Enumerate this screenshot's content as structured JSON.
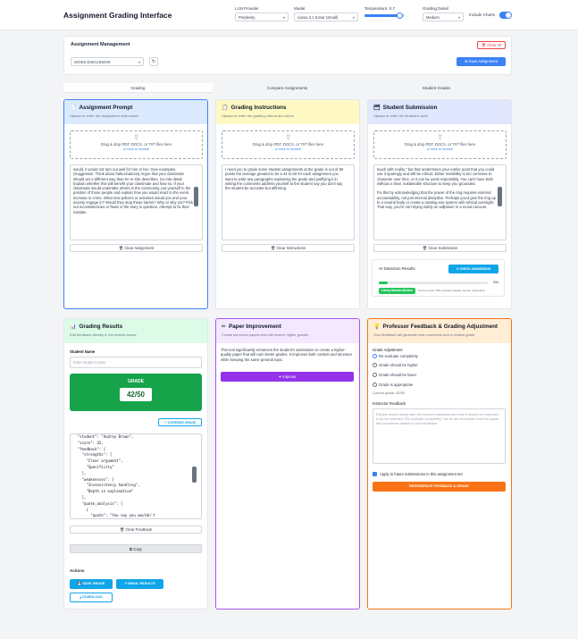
{
  "app": {
    "title": "Assignment Grading Interface"
  },
  "controls": {
    "llm_provider_label": "LLM Provider",
    "llm_provider_value": "Perplexity",
    "model_label": "Model",
    "model_value": "Llama 3.1 Sonar (Small)",
    "temperature_label": "Temperature: 0.7",
    "temperature_value": 0.7,
    "grading_detail_label": "Grading Detail",
    "grading_detail_value": "Medium",
    "include_charts_label": "Include Charts",
    "include_charts_on": true
  },
  "management": {
    "title": "Assignment Management",
    "clear_all": "Clear All",
    "selected": "GIGES DISCUSSION",
    "save_assignment": "Save Assignment"
  },
  "tabs": [
    "Grading",
    "Compare Assignments",
    "Student Grades"
  ],
  "prompt_card": {
    "title": "Assignment Prompt",
    "subtitle": "Upload or enter the assignment instructions",
    "drop_text": "Drag & drop PDF, DOCX, or TXT files here",
    "drop_link": "or click to browse",
    "text": "would, it would not turn out well for him or her. Give examples. (Suggestion: Think about hallucinations) Argue that your classmate should act a different way than he or she describes. Go into detail. Explain whether this will benefit your classmate and how so. If your classmate would undertake others in the community, put yourself in the position of those people and explain how you would react to the event increase in crime. What new policies or activities would you and your society engage in? Would they stop these harms? Why or why not? Pick out inconsistencies or flaws in the story in question. Attempt to fix their mistake.",
    "clear": "Clear Assignment"
  },
  "instructions_card": {
    "title": "Grading Instructions",
    "subtitle": "Upload or enter the grading criteria and rubric",
    "drop_text": "Drag & drop PDF, DOCX, or TXT files here",
    "drop_link": "or click to browse",
    "text": "I need you to grade some student assignments at the grade is out of 50 points the average greated to be a 44 to 50 for each assignment you want to write two paragraphs explaining the grade and justifying it in writing the comments address yourself to the student say you don't say the student be accurate but affirming",
    "clear": "Clear Instructions"
  },
  "submission_card": {
    "title": "Student Submission",
    "subtitle": "Upload or enter the student's work",
    "drop_text": "Drag & drop PDF, DOCX, or TXT files here",
    "drop_link": "or click to browse",
    "text": "touch with reality,\" but that undermines your earlier point that you could use it sparingly and still be ethical. Either invisibility is too corrosive to character over time, or it can be used responsibly. You can't have both without a clear, sustainable structure to keep you grounded.\n\nFix this by acknowledging that the power of the ring requires external accountability, not just internal discipline. Perhaps you'd give the ring up to a neutral body or create a rotating-use system with ethical oversight. That way, you're not relying solely on willpower in a moral vacuum.",
    "clear": "Clear Submission",
    "ai_title": "AI Detection Results",
    "ai_button": "CHECK SUBMISSION",
    "ai_percent_label": "8%",
    "ai_percent": 8,
    "ai_badge": "Likely Human-Written",
    "ai_note": "Scores under 30% typically indicate human authorship"
  },
  "results_card": {
    "title": "Grading Results",
    "subtitle": "Edit feedback directly in the textbox below",
    "student_name_label": "Student Name",
    "student_name_placeholder": "Enter student name",
    "grade_label": "GRADE",
    "grade_value": "42/50",
    "override": "OVERRIDE GRADE",
    "code_lines": [
      "  \"student\": \"Audrey Brown\",",
      "  \"score\": 42,",
      "  \"feedback\": {",
      "    \"strengths\": [",
      "      \"Clear argument\",",
      "      \"Specificity\"",
      "    ],",
      "    \"weaknesses\": [",
      "      \"Inconsistency handling\",",
      "      \"Depth in explanation\"",
      "    ],",
      "    \"quote_analysis\": [",
      "      {",
      "        \"quote\": \"You say you wouldn't"
    ],
    "clear_feedback": "Clear Feedback",
    "copy": "Copy",
    "actions_label": "Actions",
    "save_grade": "SAVE GRADE",
    "email_results": "EMAIL RESULTS",
    "download": "DOWNLOAD"
  },
  "improve_card": {
    "title": "Paper Improvement",
    "subtitle": "Create improved papers that will receive higher grades",
    "text": "This tool significantly enhances the student's submission to create a higher-quality paper that will earn better grades. It improves both content and structure while keeping the same general topic.",
    "button": "Improve"
  },
  "adjust_card": {
    "title": "Professor Feedback & Grading Adjustment",
    "subtitle": "Your feedback will generate new comments and a revised grade",
    "grade_adjustment_label": "Grade Adjustment",
    "options": [
      "Re-evaluate completely",
      "Grade should be higher",
      "Grade should be lower",
      "Grade is appropriate"
    ],
    "selected_index": 0,
    "current_grade": "Current grade: 42/50",
    "instructor_feedback_label": "Instructor Feedback",
    "feedback_placeholder": "Explain what's wrong with the current evaluation and how it should be improved. If you've selected \"Re-evaluate completely\" the AI will reconsider both the grade and comments based on your feedback",
    "apply_label": "Apply to future submissions in this assignment set",
    "regenerate": "REGENERATE FEEDBACK & GRADE"
  }
}
